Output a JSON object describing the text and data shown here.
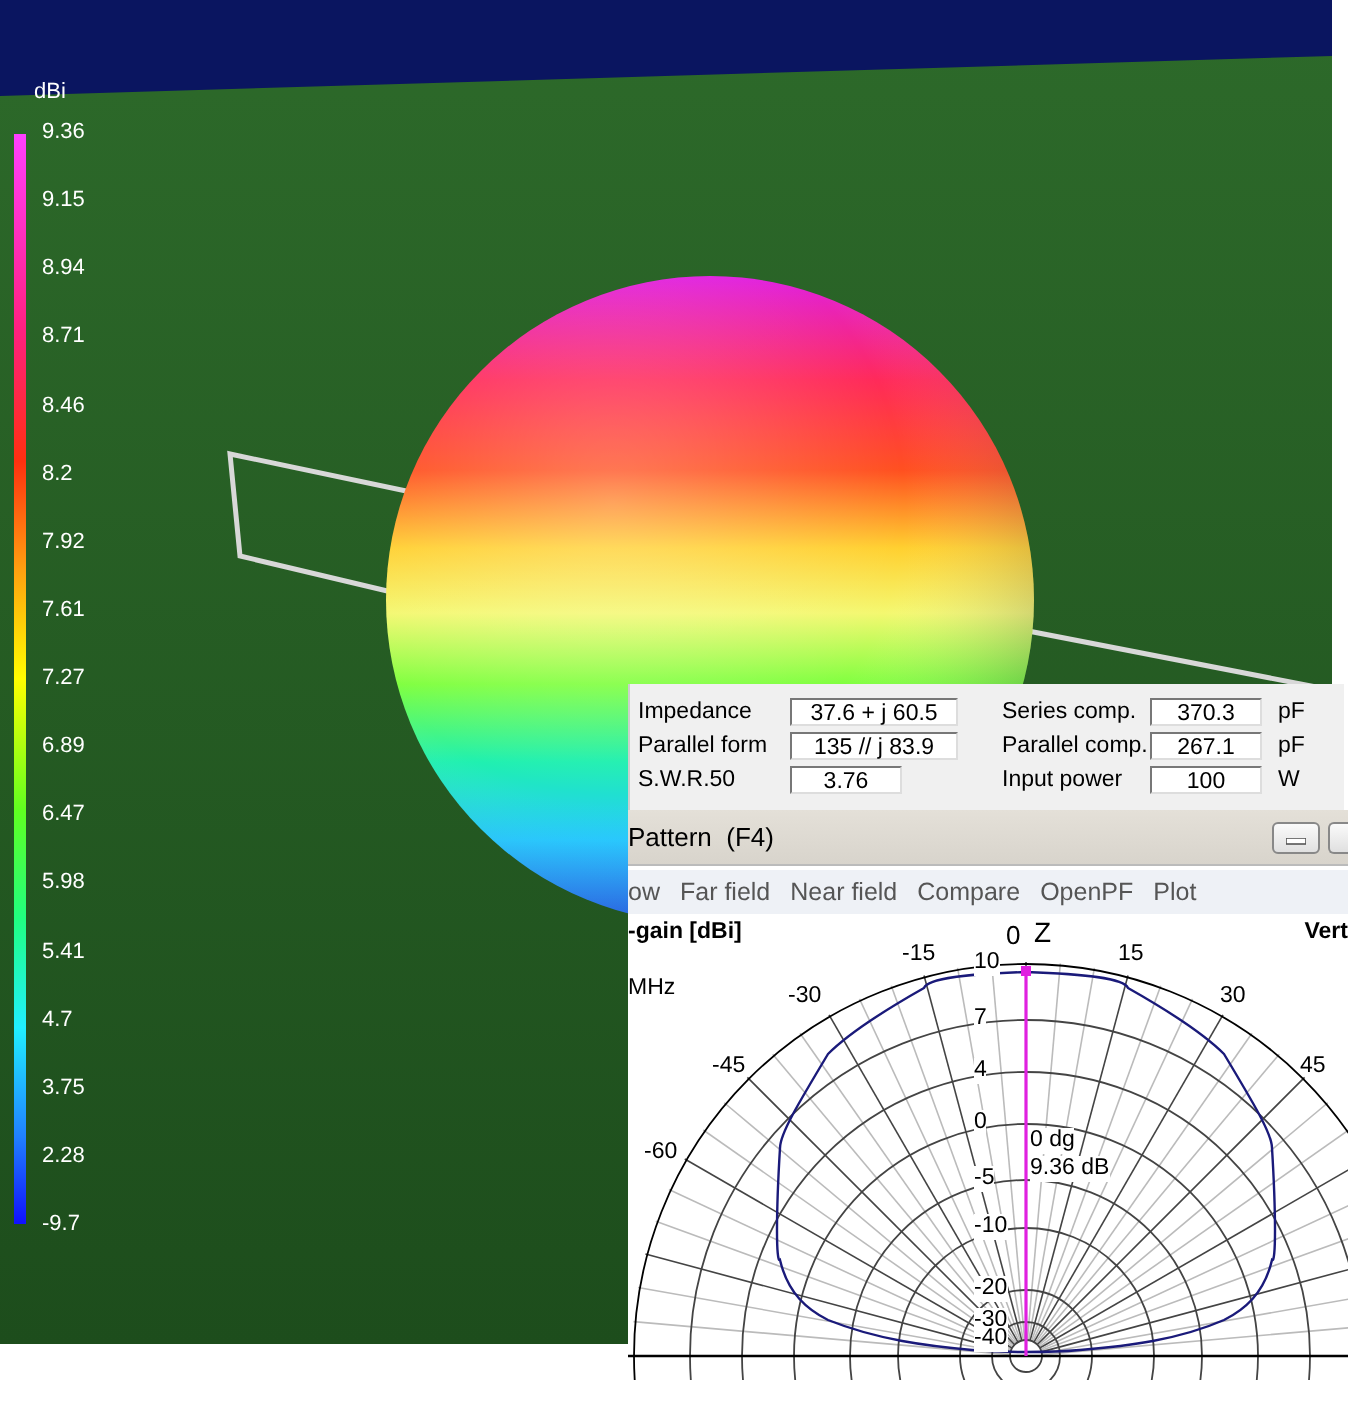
{
  "legend": {
    "unit": "dBi",
    "labels": [
      "9.36",
      "9.15",
      "8.94",
      "8.71",
      "8.46",
      "8.2",
      "7.92",
      "7.61",
      "7.27",
      "6.89",
      "6.47",
      "5.98",
      "5.41",
      "4.7",
      "3.75",
      "2.28",
      "-9.7"
    ]
  },
  "info": {
    "rows": [
      {
        "label": "Impedance",
        "value": "37.6 + j 60.5",
        "label_2": "Series comp.",
        "value_2": "370.3",
        "unit": "pF"
      },
      {
        "label": "Parallel form",
        "value": "135 // j 83.9",
        "label_2": "Parallel comp.",
        "value_2": "267.1",
        "unit": "pF"
      },
      {
        "label": "S.W.R.50",
        "value": "3.76",
        "label_2": "Input power",
        "value_2": "100",
        "unit": "W"
      }
    ]
  },
  "pattern_window": {
    "title": "Pattern  (F4)",
    "menu": [
      "ow",
      "Far field",
      "Near field",
      "Compare",
      "OpenPF",
      "Plot"
    ],
    "plot": {
      "title": "-gain [dBi]",
      "view": "Vert",
      "frequency_unit": "MHz",
      "zenith_angle": "0",
      "zenith_label": "Z",
      "angle_labels": [
        "-15",
        "15",
        "-30",
        "30",
        "-45",
        "45",
        "-60"
      ],
      "ring_labels": [
        "10",
        "7",
        "4",
        "0",
        "-5",
        "-10",
        "-20",
        "-30",
        "-40"
      ],
      "marker_angle": "0 dg",
      "marker_gain": "9.36 dB"
    }
  }
}
